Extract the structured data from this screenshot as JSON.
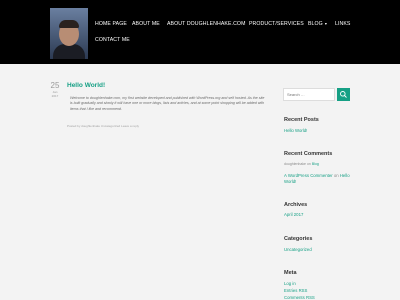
{
  "nav": {
    "items": [
      {
        "label": "HOME PAGE"
      },
      {
        "label": "ABOUT ME"
      },
      {
        "label": "ABOUT DOUGHLENHAKE.COM"
      },
      {
        "label": "PRODUCT/SERVICES"
      },
      {
        "label": "BLOG"
      },
      {
        "label": "LINKS"
      },
      {
        "label": "CONTACT ME"
      }
    ],
    "blog_caret": "▾"
  },
  "post": {
    "date_day": "25",
    "date_month": "Jan",
    "date_year": "2017",
    "title": "Hello World!",
    "body": "Welcome to doughlenhake.com, my first website developed and published with WordPress.org and self hosted. As the site is built gradually and slowly it will have one or more blogs, lists and articles, and at some point shopping will be added with items that I like and recommend.",
    "meta": "Posted by doughlenhake Uncategorized Leave a reply"
  },
  "sidebar": {
    "search_placeholder": "Search …",
    "recent_posts": {
      "title": "Recent Posts",
      "items": [
        {
          "label": "Hello World!"
        }
      ]
    },
    "recent_comments": {
      "title": "Recent Comments",
      "line1_prefix": "doughlenhake on",
      "line1_link": "Blog",
      "line2_link": "A WordPress Commenter",
      "line2_on": "on",
      "line2_target": "Hello",
      "line3_target": "World!"
    },
    "archives": {
      "title": "Archives",
      "items": [
        {
          "label": "April 2017"
        }
      ]
    },
    "categories": {
      "title": "Categories",
      "items": [
        {
          "label": "Uncategorized"
        }
      ]
    },
    "meta": {
      "title": "Meta",
      "items": [
        {
          "label": "Log in"
        },
        {
          "label": "Entries RSS"
        },
        {
          "label": "Comments RSS"
        }
      ]
    }
  },
  "colors": {
    "header_bg": "#000000",
    "accent": "#16a085",
    "page_bg": "#f3f3f3"
  }
}
